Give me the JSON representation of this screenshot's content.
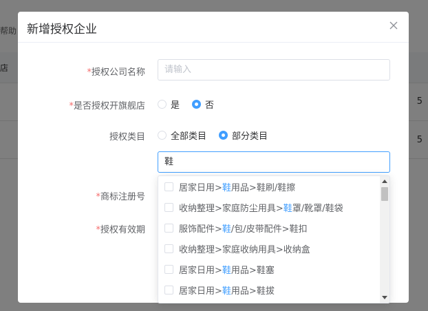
{
  "background": {
    "help_text": "帮助",
    "header_text": "店",
    "row_values": [
      "5",
      "5"
    ]
  },
  "modal": {
    "title": "新增授权企业",
    "close_icon": "close-icon"
  },
  "form": {
    "company_name": {
      "required_mark": "*",
      "label": "授权公司名称",
      "placeholder": "请输入"
    },
    "flagship": {
      "required_mark": "*",
      "label": "是否授权开旗舰店",
      "options": [
        "是",
        "否"
      ],
      "selected": "否"
    },
    "category": {
      "label": "授权类目",
      "options": [
        "全部类目",
        "部分类目"
      ],
      "selected": "部分类目"
    },
    "category_search": {
      "value": "鞋"
    },
    "trademark": {
      "required_mark": "*",
      "label": "商标注册号"
    },
    "validity": {
      "required_mark": "*",
      "label": "授权有效期"
    }
  },
  "dropdown": {
    "highlight_color": "#409eff",
    "items": [
      {
        "pre": "居家日用>",
        "hl": "鞋",
        "post": "用品>鞋刷/鞋擦"
      },
      {
        "pre": "收纳整理>家庭防尘用具>",
        "hl": "鞋",
        "post": "罩/靴罩/鞋袋"
      },
      {
        "pre": "服饰配件>",
        "hl": "鞋",
        "post": "/包/皮带配件>鞋扣"
      },
      {
        "pre": "收纳整理>家庭收纳用具>收纳盒",
        "hl": "",
        "post": ""
      },
      {
        "pre": "居家日用>",
        "hl": "鞋",
        "post": "用品>鞋塞"
      },
      {
        "pre": "居家日用>",
        "hl": "鞋",
        "post": "用品>鞋拔"
      }
    ]
  }
}
